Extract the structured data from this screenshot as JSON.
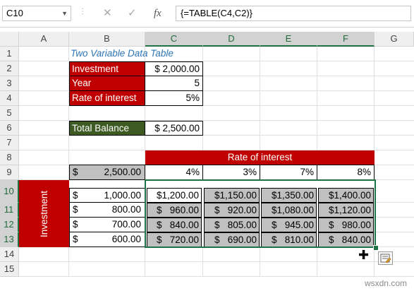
{
  "formula_bar": {
    "name_box": "C10",
    "formula": "{=TABLE(C4,C2)}",
    "cancel_icon": "✕",
    "enter_icon": "✓",
    "fx_icon": "fx"
  },
  "columns": [
    "A",
    "B",
    "C",
    "D",
    "E",
    "F",
    "G"
  ],
  "rows": [
    "1",
    "2",
    "3",
    "4",
    "5",
    "6",
    "7",
    "8",
    "9",
    "10",
    "11",
    "12",
    "13",
    "14",
    "15"
  ],
  "sheet": {
    "title": "Two Variable Data Table",
    "inputs": [
      {
        "label": "Investment",
        "value": "$ 2,000.00"
      },
      {
        "label": "Year",
        "value": "5"
      },
      {
        "label": "Rate of interest",
        "value": "5%"
      }
    ],
    "total_label": "Total Balance",
    "total_value": "$ 2,500.00",
    "rate_header": "Rate of interest",
    "corner_currency": "$",
    "corner_value": "2,500.00",
    "rates": [
      "4%",
      "3%",
      "7%",
      "8%"
    ],
    "investment_label": "Investment",
    "row_currency": "$",
    "investments": [
      "1,000.00",
      "800.00",
      "700.00",
      "600.00"
    ],
    "results": [
      [
        "$1,200.00",
        "$1,150.00",
        "$1,350.00",
        "$1,400.00"
      ],
      [
        "$   960.00",
        "$   920.00",
        "$1,080.00",
        "$1,120.00"
      ],
      [
        "$   840.00",
        "$   805.00",
        "$   945.00",
        "$   980.00"
      ],
      [
        "$   720.00",
        "$   690.00",
        "$   810.00",
        "$   840.00"
      ]
    ]
  },
  "watermark": "wsxdn.com",
  "colors": {
    "red": "#c00000",
    "green": "#3c5a22",
    "grey": "#c0c0c0",
    "selection": "#1f7244"
  }
}
